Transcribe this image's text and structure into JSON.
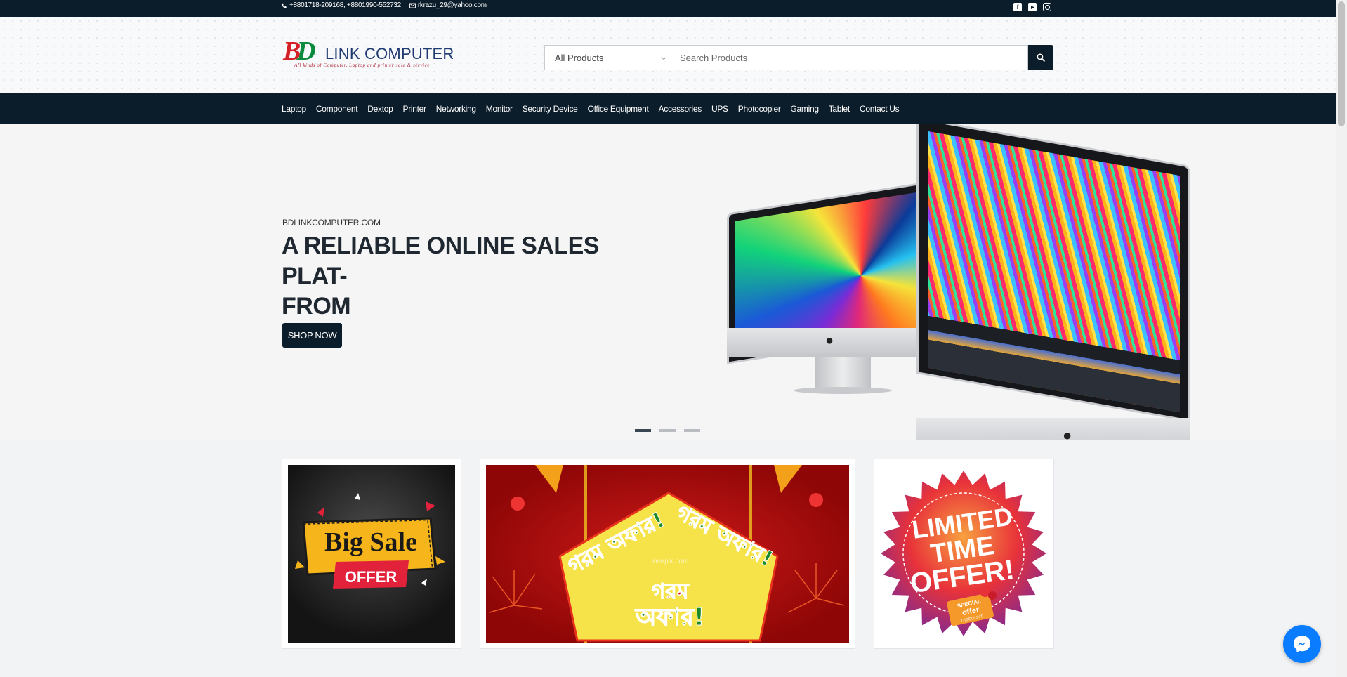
{
  "topbar": {
    "phone": "+8801718-209168, +8801990-552732",
    "email": "rkrazu_29@yahoo.com",
    "social": [
      "facebook-icon",
      "youtube-icon",
      "instagram-icon"
    ]
  },
  "header": {
    "logo": {
      "bd": "BD",
      "b": "B",
      "d": "D",
      "name": "LINK COMPUTER",
      "tagline": "All kinds of Computer, Laptop and printer sale & service"
    },
    "search": {
      "category": "All Products",
      "placeholder": "Search Products"
    }
  },
  "nav": {
    "items": [
      "Laptop",
      "Component",
      "Dextop",
      "Printer",
      "Networking",
      "Monitor",
      "Security Device",
      "Office Equipment",
      "Accessories",
      "UPS",
      "Photocopier",
      "Gaming",
      "Tablet",
      "Contact Us"
    ]
  },
  "hero": {
    "subtitle": "BDLINKCOMPUTER.COM",
    "title_line1": "A RELIABLE ONLINE SALES PLAT-",
    "title_line2": "FROM",
    "button": "SHOP NOW",
    "active_slide": 1,
    "slide_count": 3
  },
  "banners": {
    "big_sale": {
      "line1": "Big Sale",
      "line2": "OFFER"
    },
    "festival": {
      "text1": "গরম অফার!",
      "text2": "গরম অফার!",
      "text3": "গরম",
      "text4": "অফার!",
      "watermark": "lovepik.com"
    },
    "limited": {
      "line1": "LIMITED",
      "line2": "TIME",
      "line3": "OFFER!",
      "badge1": "SPECIAL",
      "badge2": "offer",
      "badge3": "DISCOUNT"
    }
  },
  "colors": {
    "navy": "#0b1d2b",
    "brand_red": "#d42027",
    "brand_green": "#0a8a3c",
    "brand_blue": "#1f3a70",
    "messenger": "#0a7cff"
  }
}
